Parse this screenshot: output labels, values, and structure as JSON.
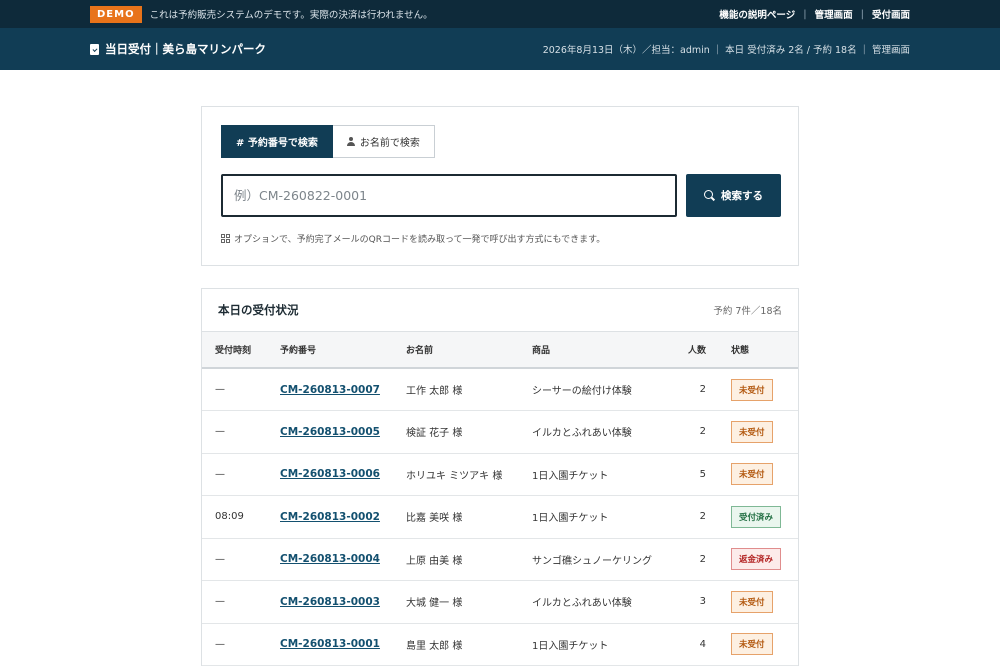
{
  "demo_bar": {
    "badge": "DEMO",
    "message": "これは予約販売システムのデモです。実際の決済は行われません。",
    "links": [
      "機能の説明ページ",
      "管理画面",
      "受付画面"
    ]
  },
  "header": {
    "title": "当日受付｜美ら島マリンパーク",
    "date_staff": "2026年8月13日（木）／担当：admin",
    "today_summary": "本日 受付済み 2名 / 予約 18名",
    "admin_link": "管理画面"
  },
  "search": {
    "tab_number": "# 予約番号で検索",
    "tab_name": "お名前で検索",
    "placeholder": "例）CM-260822-0001",
    "button": "検索する",
    "hint": "オプションで、予約完了メールのQRコードを読み取って一発で呼び出す方式にもできます。"
  },
  "status": {
    "title": "本日の受付状況",
    "count": "予約 7件／18名",
    "columns": [
      "受付時刻",
      "予約番号",
      "お名前",
      "商品",
      "人数",
      "状態"
    ],
    "rows": [
      {
        "time": "—",
        "number": "CM-260813-0007",
        "name": "工作 太郎 様",
        "product": "シーサーの絵付け体験",
        "people": "2",
        "state": "未受付"
      },
      {
        "time": "—",
        "number": "CM-260813-0005",
        "name": "検証 花子 様",
        "product": "イルカとふれあい体験",
        "people": "2",
        "state": "未受付"
      },
      {
        "time": "—",
        "number": "CM-260813-0006",
        "name": "ホリユキ ミツアキ 様",
        "product": "1日入園チケット",
        "people": "5",
        "state": "未受付"
      },
      {
        "time": "08:09",
        "number": "CM-260813-0002",
        "name": "比嘉 美咲 様",
        "product": "1日入園チケット",
        "people": "2",
        "state": "受付済み"
      },
      {
        "time": "—",
        "number": "CM-260813-0004",
        "name": "上原 由美 様",
        "product": "サンゴ礁シュノーケリング",
        "people": "2",
        "state": "返金済み"
      },
      {
        "time": "—",
        "number": "CM-260813-0003",
        "name": "大城 健一 様",
        "product": "イルカとふれあい体験",
        "people": "3",
        "state": "未受付"
      },
      {
        "time": "—",
        "number": "CM-260813-0001",
        "name": "島里 太郎 様",
        "product": "1日入園チケット",
        "people": "4",
        "state": "未受付"
      }
    ]
  },
  "colors": {
    "navy": "#113d55",
    "dark_navy": "#0e2a3a",
    "demo_orange": "#e8731a",
    "pending": "#b35910",
    "done": "#237044",
    "refund": "#b32424"
  }
}
